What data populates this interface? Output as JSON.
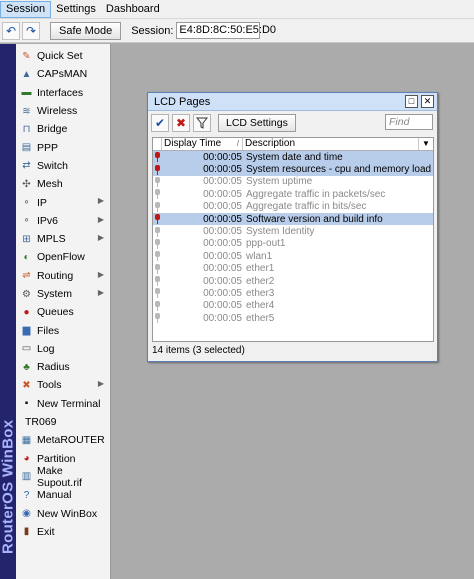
{
  "menu": {
    "items": [
      "Session",
      "Settings",
      "Dashboard"
    ]
  },
  "toolbar": {
    "safe_mode_label": "Safe Mode",
    "session_label": "Session:",
    "session_value": "E4:8D:8C:50:E5:D0"
  },
  "brand": {
    "text": "RouterOS WinBox"
  },
  "sidebar": {
    "items": [
      {
        "label": "Quick Set",
        "icon": "wand-icon",
        "glyph": "✎",
        "color": "#c9592a"
      },
      {
        "label": "CAPsMAN",
        "icon": "antenna-icon",
        "glyph": "▲",
        "color": "#3a6a9a"
      },
      {
        "label": "Interfaces",
        "icon": "interfaces-icon",
        "glyph": "▬",
        "color": "#2f7a2f"
      },
      {
        "label": "Wireless",
        "icon": "wireless-icon",
        "glyph": "≋",
        "color": "#3a6a9a"
      },
      {
        "label": "Bridge",
        "icon": "bridge-icon",
        "glyph": "⊓",
        "color": "#3a6a9a"
      },
      {
        "label": "PPP",
        "icon": "ppp-icon",
        "glyph": "▤",
        "color": "#3a6a9a"
      },
      {
        "label": "Switch",
        "icon": "switch-icon",
        "glyph": "⇄",
        "color": "#3a6a9a"
      },
      {
        "label": "Mesh",
        "icon": "mesh-icon",
        "glyph": "✣",
        "color": "#555555"
      },
      {
        "label": "IP",
        "icon": "ip-icon",
        "glyph": "∘",
        "color": "#555555",
        "submenu": true
      },
      {
        "label": "IPv6",
        "icon": "ipv6-icon",
        "glyph": "∘",
        "color": "#555555",
        "submenu": true
      },
      {
        "label": "MPLS",
        "icon": "mpls-icon",
        "glyph": "⊞",
        "color": "#3a6a9a",
        "submenu": true
      },
      {
        "label": "OpenFlow",
        "icon": "openflow-icon",
        "glyph": "◐",
        "color": "#2f7a2f"
      },
      {
        "label": "Routing",
        "icon": "routing-icon",
        "glyph": "⇌",
        "color": "#c9592a",
        "submenu": true
      },
      {
        "label": "System",
        "icon": "system-icon",
        "glyph": "⚙",
        "color": "#555555",
        "submenu": true
      },
      {
        "label": "Queues",
        "icon": "queues-icon",
        "glyph": "●",
        "color": "#c01818"
      },
      {
        "label": "Files",
        "icon": "files-icon",
        "glyph": "▆",
        "color": "#3a6ab0"
      },
      {
        "label": "Log",
        "icon": "log-icon",
        "glyph": "▭",
        "color": "#555555"
      },
      {
        "label": "Radius",
        "icon": "radius-icon",
        "glyph": "♣",
        "color": "#2f7a2f"
      },
      {
        "label": "Tools",
        "icon": "tools-icon",
        "glyph": "✖",
        "color": "#c9592a",
        "submenu": true
      },
      {
        "label": "New Terminal",
        "icon": "terminal-icon",
        "glyph": "▪",
        "color": "#111111"
      },
      {
        "label": "TR069",
        "icon": "",
        "glyph": "",
        "color": "#000000"
      },
      {
        "label": "MetaROUTER",
        "icon": "metarouter-icon",
        "glyph": "▦",
        "color": "#3a6a9a"
      },
      {
        "label": "Partition",
        "icon": "partition-icon",
        "glyph": "◕",
        "color": "#c01818"
      },
      {
        "label": "Make Supout.rif",
        "icon": "supout-icon",
        "glyph": "▥",
        "color": "#3a6a9a"
      },
      {
        "label": "Manual",
        "icon": "manual-icon",
        "glyph": "?",
        "color": "#2f5faa"
      },
      {
        "label": "New WinBox",
        "icon": "winbox-icon",
        "glyph": "◉",
        "color": "#3a6ab0"
      },
      {
        "label": "Exit",
        "icon": "exit-icon",
        "glyph": "▮",
        "color": "#7a3a1a"
      }
    ]
  },
  "lcd": {
    "title": "LCD Pages",
    "settings_button": "LCD Settings",
    "find_placeholder": "Find",
    "columns": [
      "Display Time",
      "Description"
    ],
    "rows": [
      {
        "time": "00:00:05",
        "desc": "System date and time",
        "state": "selected",
        "pin": "red"
      },
      {
        "time": "00:00:05",
        "desc": "System resources - cpu and memory load",
        "state": "selected",
        "pin": "red"
      },
      {
        "time": "00:00:05",
        "desc": "System uptime",
        "state": "disabled",
        "pin": "grey"
      },
      {
        "time": "00:00:05",
        "desc": "Aggregate traffic in packets/sec",
        "state": "disabled",
        "pin": "grey"
      },
      {
        "time": "00:00:05",
        "desc": "Aggregate traffic in bits/sec",
        "state": "disabled",
        "pin": "grey"
      },
      {
        "time": "00:00:05",
        "desc": "Software version and build info",
        "state": "selected",
        "pin": "red"
      },
      {
        "time": "00:00:05",
        "desc": "System Identity",
        "state": "disabled",
        "pin": "grey"
      },
      {
        "time": "00:00:05",
        "desc": "ppp-out1",
        "state": "disabled",
        "pin": "grey"
      },
      {
        "time": "00:00:05",
        "desc": "wlan1",
        "state": "disabled",
        "pin": "grey"
      },
      {
        "time": "00:00:05",
        "desc": "ether1",
        "state": "disabled",
        "pin": "grey"
      },
      {
        "time": "00:00:05",
        "desc": "ether2",
        "state": "disabled",
        "pin": "grey"
      },
      {
        "time": "00:00:05",
        "desc": "ether3",
        "state": "disabled",
        "pin": "grey"
      },
      {
        "time": "00:00:05",
        "desc": "ether4",
        "state": "disabled",
        "pin": "grey"
      },
      {
        "time": "00:00:05",
        "desc": "ether5",
        "state": "disabled",
        "pin": "grey"
      }
    ],
    "status": "14 items (3 selected)"
  }
}
